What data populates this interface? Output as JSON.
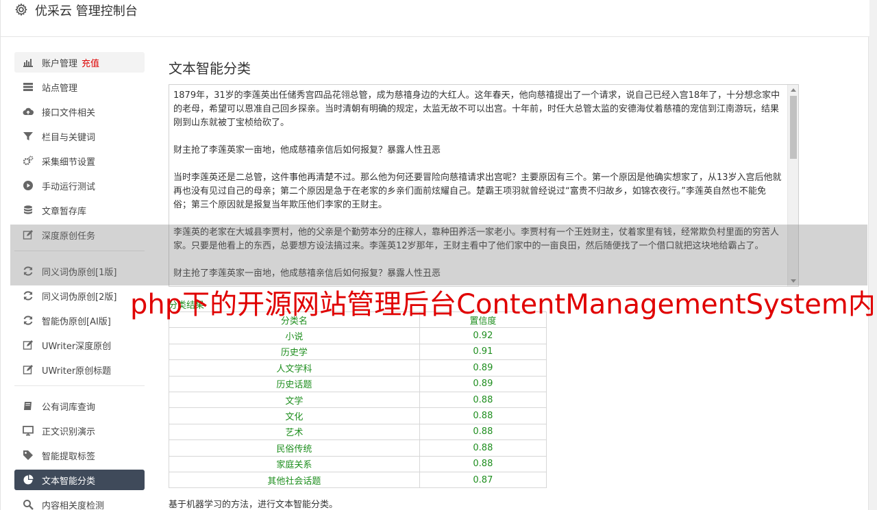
{
  "app": {
    "title": "优采云 管理控制台"
  },
  "sidebar": {
    "items": [
      {
        "label": "账户管理",
        "extra": "充值",
        "icon": "bar-chart-icon"
      },
      {
        "label": "站点管理",
        "icon": "server-icon"
      },
      {
        "label": "接口文件相关",
        "icon": "cloud-upload-icon"
      },
      {
        "label": "栏目与关键词",
        "icon": "filter-icon"
      },
      {
        "label": "采集细节设置",
        "icon": "cogs-icon"
      },
      {
        "label": "手动运行测试",
        "icon": "play-circle-icon"
      },
      {
        "label": "文章暂存库",
        "icon": "database-icon"
      },
      {
        "label": "深度原创任务",
        "icon": "edit-icon"
      },
      {
        "label": "同义词伪原创[1版]",
        "icon": "refresh-icon"
      },
      {
        "label": "同义词伪原创[2版]",
        "icon": "refresh-icon"
      },
      {
        "label": "智能伪原创[AI版]",
        "icon": "refresh-icon"
      },
      {
        "label": "UWriter深度原创",
        "icon": "edit-icon"
      },
      {
        "label": "UWriter原创标题",
        "icon": "edit-icon"
      },
      {
        "label": "公有词库查询",
        "icon": "book-icon"
      },
      {
        "label": "正文识别演示",
        "icon": "monitor-icon"
      },
      {
        "label": "智能提取标签",
        "icon": "tag-icon"
      },
      {
        "label": "文本智能分类",
        "icon": "pie-chart-icon"
      },
      {
        "label": "内容相关度检测",
        "icon": "search-icon"
      }
    ]
  },
  "main": {
    "title": "文本智能分类",
    "text_paragraphs": [
      "1879年，31岁的李莲英出任储秀宫四品花翎总管，成为慈禧身边的大红人。这年春天，他向慈禧提出了一个请求，说自己已经入宫18年了，十分想念家中的老母，希望可以恩准自己回乡探亲。当时清朝有明确的规定，太监无故不可以出宫。十年前，时任大总管太监的安德海仗着慈禧的宠信到江南游玩，结果刚到山东就被丁宝桢给砍了。",
      "财主抢了李莲英家一亩地，他成慈禧亲信后如何报复？暴露人性丑恶",
      "当时李莲英还是二总管，这件事他再清楚不过。那么他为何还要冒险向慈禧请求出宫呢？主要原因有三个。第一个原因是他确实想家了，从13岁入宫后他就再也没有见过自己的母亲；第二个原因是急于在老家的乡亲们面前炫耀自己。楚霸王项羽就曾经说过“富贵不归故乡，如锦衣夜行。”李莲英自然也不能免俗；第三个原因就是报复当年欺压他们李家的王财主。",
      "李莲英的老家在大城县李贾村，他的父亲是个勤劳本分的庄稼人，靠种田养活一家老小。李贾村有一个王姓财主，仗着家里有钱，经常欺负村里面的穷苦人家。只要是他看上的东西，总要想方设法搞过来。李莲英12岁那年，王财主看中了他们家中的一亩良田，然后随便找了一个借口就把这块地给霸占了。",
      "财主抢了李莲英家一亩地，他成慈禧亲信后如何报复？暴露人性丑恶"
    ],
    "result_label": "分类结果",
    "table": {
      "headers": [
        "分类名",
        "置信度"
      ],
      "rows": [
        [
          "小说",
          "0.92"
        ],
        [
          "历史学",
          "0.91"
        ],
        [
          "人文学科",
          "0.89"
        ],
        [
          "历史话题",
          "0.89"
        ],
        [
          "文学",
          "0.88"
        ],
        [
          "文化",
          "0.88"
        ],
        [
          "艺术",
          "0.88"
        ],
        [
          "民俗传统",
          "0.88"
        ],
        [
          "家庭关系",
          "0.88"
        ],
        [
          "其他社会话题",
          "0.87"
        ]
      ]
    },
    "note": "基于机器学习的方法，进行文本智能分类。"
  },
  "watermark": "php下的开源网站管理后台ContentManagementSystem内",
  "colors": {
    "accent_active": "#3f4a5a",
    "result_green": "#1e8e1e",
    "watermark_red": "#e00000",
    "extra_red": "#dd0000"
  }
}
